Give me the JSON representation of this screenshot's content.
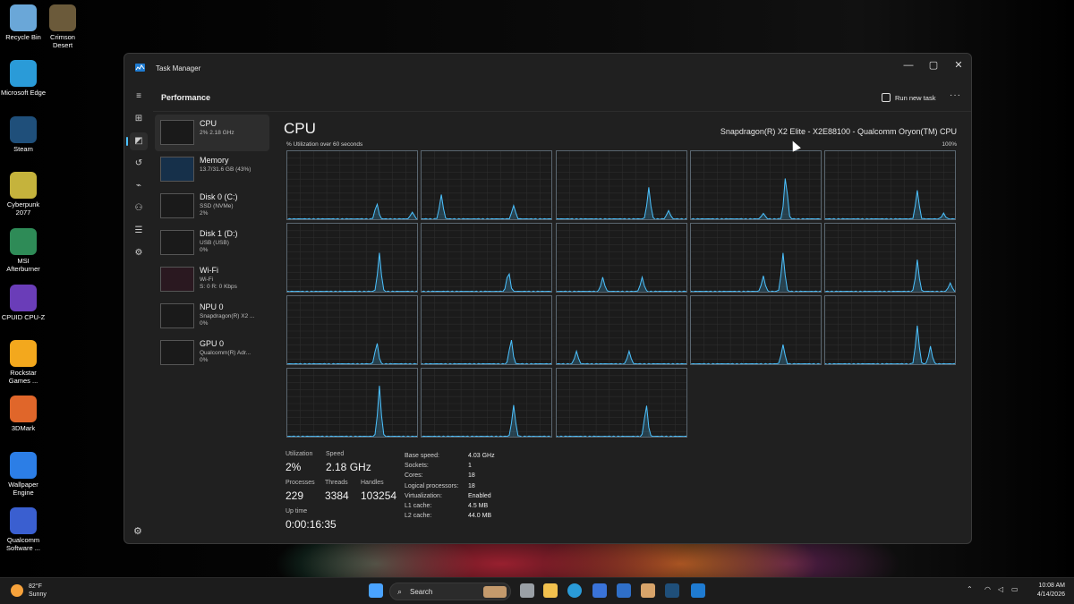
{
  "desktop": {
    "icons": [
      {
        "label": "Recycle Bin",
        "icon": "recycle-bin-icon",
        "color": "#6aa7d8"
      },
      {
        "label": "Crimson Desert",
        "icon": "crimson-desert-icon",
        "color": "#6b5a3a"
      },
      {
        "label": "Microsoft Edge",
        "icon": "edge-icon",
        "color": "#2a9bd8"
      },
      {
        "label": "Steam",
        "icon": "steam-icon",
        "color": "#1f4f7a"
      },
      {
        "label": "Cyberpunk 2077",
        "icon": "cyberpunk-icon",
        "color": "#c5b33c"
      },
      {
        "label": "MSI Afterburner",
        "icon": "msi-afterburner-icon",
        "color": "#2e8b57"
      },
      {
        "label": "CPUID CPU-Z",
        "icon": "cpuz-icon",
        "color": "#6a3db8"
      },
      {
        "label": "Rockstar Games ...",
        "icon": "rockstar-icon",
        "color": "#f3a81d"
      },
      {
        "label": "3DMark",
        "icon": "3dmark-icon",
        "color": "#e0662a"
      },
      {
        "label": "Wallpaper Engine",
        "icon": "wallpaper-engine-icon",
        "color": "#2c7ee6"
      },
      {
        "label": "Qualcomm Software ...",
        "icon": "qualcomm-icon",
        "color": "#3a5fd0"
      }
    ]
  },
  "window": {
    "title": "Task Manager",
    "page_title": "Performance",
    "run_new_task": "Run new task",
    "more": "···",
    "controls": {
      "minimize": "—",
      "maximize": "▢",
      "close": "✕"
    }
  },
  "nav_rail": [
    "hamburger-icon",
    "processes-icon",
    "performance-icon",
    "app-history-icon",
    "startup-apps-icon",
    "users-icon",
    "details-icon",
    "services-icon"
  ],
  "devices": [
    {
      "name": "CPU",
      "sub1": "2% 2.18 GHz",
      "sub2": ""
    },
    {
      "name": "Memory",
      "sub1": "13.7/31.6 GB (43%)",
      "sub2": ""
    },
    {
      "name": "Disk 0 (C:)",
      "sub1": "SSD (NVMe)",
      "sub2": "2%"
    },
    {
      "name": "Disk 1 (D:)",
      "sub1": "USB (USB)",
      "sub2": "0%"
    },
    {
      "name": "Wi-Fi",
      "sub1": "Wi-Fi",
      "sub2": "S: 0 R: 0 Kbps"
    },
    {
      "name": "NPU 0",
      "sub1": "Snapdragon(R) X2 ...",
      "sub2": "0%"
    },
    {
      "name": "GPU 0",
      "sub1": "Qualcomm(R) Adr...",
      "sub2": "0%"
    }
  ],
  "cpu": {
    "title": "CPU",
    "model": "Snapdragon(R) X2 Elite - X2E88100 - Qualcomm Oryon(TM) CPU",
    "util_label": "% Utilization over 60 seconds",
    "util_max": "100%",
    "graph_color": "#4cc2ff",
    "stats": {
      "utilization_label": "Utilization",
      "utilization": "2%",
      "speed_label": "Speed",
      "speed": "2.18 GHz",
      "processes_label": "Processes",
      "processes": "229",
      "threads_label": "Threads",
      "threads": "3384",
      "handles_label": "Handles",
      "handles": "103254",
      "uptime_label": "Up time",
      "uptime": "0:00:16:35"
    },
    "specs": [
      {
        "k": "Base speed:",
        "v": "4.03 GHz"
      },
      {
        "k": "Sockets:",
        "v": "1"
      },
      {
        "k": "Cores:",
        "v": "18"
      },
      {
        "k": "Logical processors:",
        "v": "18"
      },
      {
        "k": "Virtualization:",
        "v": "Enabled"
      },
      {
        "k": "L1 cache:",
        "v": "4.5 MB"
      },
      {
        "k": "L2 cache:",
        "v": "44.0 MB"
      }
    ]
  },
  "core_peaks": [
    [
      {
        "at": 0.68,
        "h": 0.22
      },
      {
        "at": 0.95,
        "h": 0.1
      }
    ],
    [
      {
        "at": 0.15,
        "h": 0.35
      },
      {
        "at": 0.7,
        "h": 0.2
      }
    ],
    [
      {
        "at": 0.7,
        "h": 0.45
      },
      {
        "at": 0.85,
        "h": 0.12
      }
    ],
    [
      {
        "at": 0.72,
        "h": 0.6
      },
      {
        "at": 0.55,
        "h": 0.08
      }
    ],
    [
      {
        "at": 0.7,
        "h": 0.42
      },
      {
        "at": 0.9,
        "h": 0.08
      }
    ],
    [
      {
        "at": 0.7,
        "h": 0.55
      }
    ],
    [
      {
        "at": 0.66,
        "h": 0.28
      }
    ],
    [
      {
        "at": 0.35,
        "h": 0.2
      },
      {
        "at": 0.65,
        "h": 0.2
      }
    ],
    [
      {
        "at": 0.7,
        "h": 0.55
      },
      {
        "at": 0.55,
        "h": 0.22
      }
    ],
    [
      {
        "at": 0.7,
        "h": 0.45
      },
      {
        "at": 0.95,
        "h": 0.12
      }
    ],
    [
      {
        "at": 0.68,
        "h": 0.3
      }
    ],
    [
      {
        "at": 0.68,
        "h": 0.35
      }
    ],
    [
      {
        "at": 0.15,
        "h": 0.18
      },
      {
        "at": 0.55,
        "h": 0.18
      }
    ],
    [
      {
        "at": 0.7,
        "h": 0.28
      }
    ],
    [
      {
        "at": 0.7,
        "h": 0.55
      },
      {
        "at": 0.8,
        "h": 0.25
      }
    ],
    [
      {
        "at": 0.7,
        "h": 0.72
      }
    ],
    [
      {
        "at": 0.7,
        "h": 0.45
      }
    ],
    [
      {
        "at": 0.68,
        "h": 0.45
      }
    ]
  ],
  "taskbar": {
    "weather_temp": "82°F",
    "weather_desc": "Sunny",
    "search": "Search",
    "time": "10:08 AM",
    "date": "4/14/2026"
  }
}
